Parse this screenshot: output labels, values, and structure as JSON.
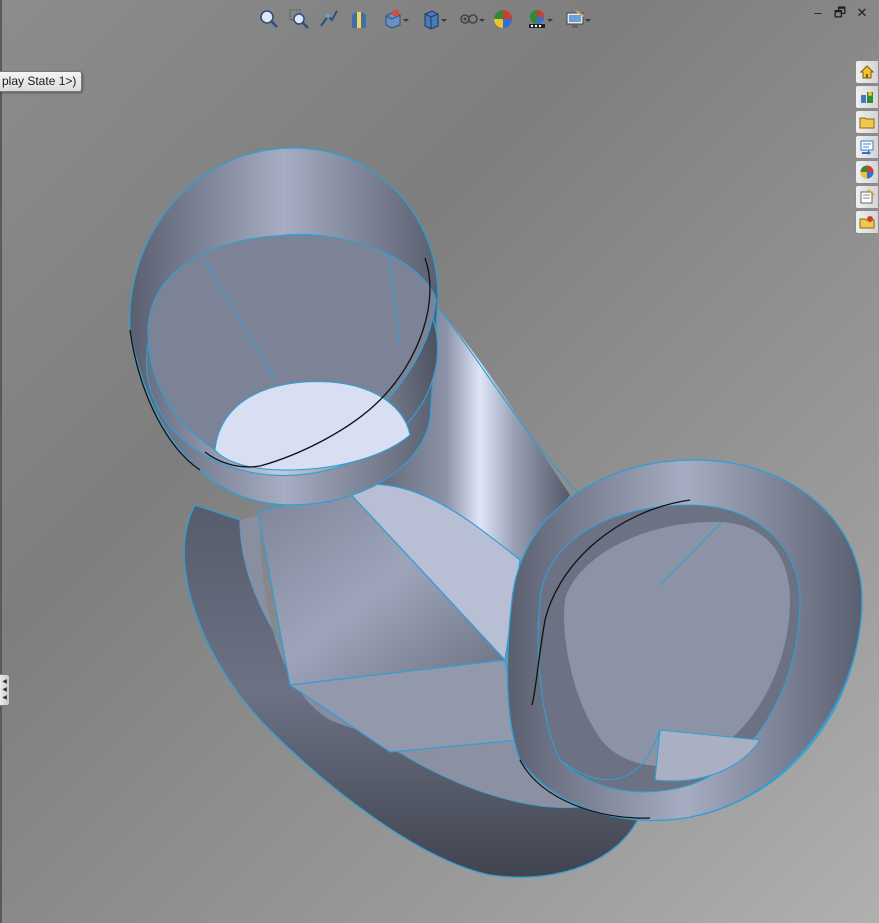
{
  "config_tag": {
    "text": "play State 1>)"
  },
  "heads_up_toolbar": {
    "buttons": [
      {
        "icon": "zoom-to-fit-icon",
        "has_menu": false
      },
      {
        "icon": "zoom-to-area-icon",
        "has_menu": false
      },
      {
        "icon": "previous-view-icon",
        "has_menu": false
      },
      {
        "icon": "section-view-icon",
        "has_menu": false
      },
      {
        "icon": "view-orientation-icon",
        "has_menu": true
      },
      {
        "icon": "display-style-icon",
        "has_menu": true
      },
      {
        "icon": "hide-show-items-icon",
        "has_menu": true
      },
      {
        "icon": "edit-appearance-icon",
        "has_menu": false
      },
      {
        "icon": "apply-scene-icon",
        "has_menu": true
      },
      {
        "icon": "view-settings-icon",
        "has_menu": true
      }
    ]
  },
  "window_controls": {
    "minimize": "–",
    "restore": "🗗",
    "close": "✕"
  },
  "task_pane": {
    "tabs": [
      {
        "icon": "home-icon"
      },
      {
        "icon": "design-library-icon"
      },
      {
        "icon": "file-explorer-icon"
      },
      {
        "icon": "view-palette-icon"
      },
      {
        "icon": "appearances-icon"
      },
      {
        "icon": "custom-properties-icon"
      },
      {
        "icon": "document-recovery-icon"
      }
    ]
  },
  "colors": {
    "edge_blue": "#2f9fd4",
    "surface_light": "#cfd6ea",
    "surface_dark": "#4f5463",
    "background": "#888888"
  }
}
